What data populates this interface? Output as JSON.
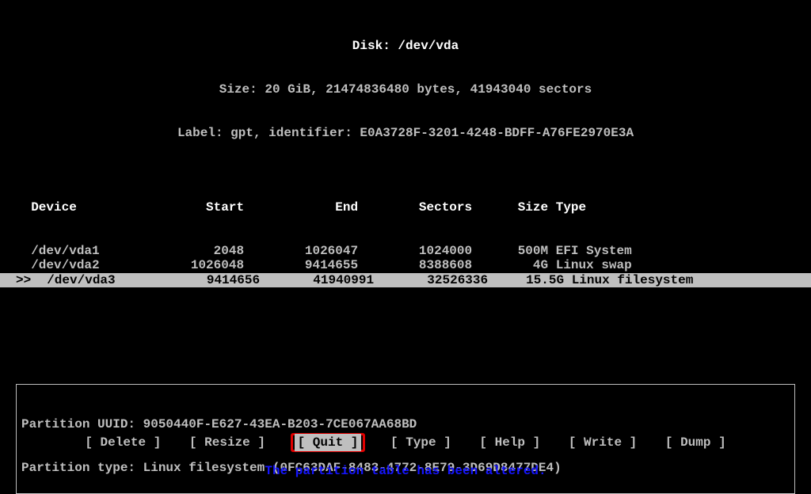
{
  "header": {
    "disk_line": "Disk: /dev/vda",
    "size_line": "Size: 20 GiB, 21474836480 bytes, 41943040 sectors",
    "label_line": "Label: gpt, identifier: E0A3728F-3201-4248-BDFF-A76FE2970E3A"
  },
  "columns": {
    "device": "Device",
    "start": "Start",
    "end": "End",
    "sectors": "Sectors",
    "size": "Size",
    "type": "Type"
  },
  "partitions": [
    {
      "device": "/dev/vda1",
      "start": "2048",
      "end": "1026047",
      "sectors": "1024000",
      "size": "500M",
      "type": "EFI System",
      "selected": false
    },
    {
      "device": "/dev/vda2",
      "start": "1026048",
      "end": "9414655",
      "sectors": "8388608",
      "size": "4G",
      "type": "Linux swap",
      "selected": false
    },
    {
      "device": "/dev/vda3",
      "start": "9414656",
      "end": "41940991",
      "sectors": "32526336",
      "size": "15.5G",
      "type": "Linux filesystem",
      "selected": true
    }
  ],
  "selected_prefix": ">>",
  "info": {
    "uuid_line": "Partition UUID: 9050440F-E627-43EA-B203-7CE067AA68BD",
    "type_line": "Partition type: Linux filesystem (0FC63DAF-8483-4772-8E79-3D69D8477DE4)"
  },
  "menu": {
    "delete": "[ Delete ]",
    "resize": "[ Resize ]",
    "quit": "[  Quit  ]",
    "type": "[  Type  ]",
    "help": "[  Help  ]",
    "write": "[  Write ]",
    "dump": "[  Dump  ]"
  },
  "status_message": "The partition table has been altered."
}
